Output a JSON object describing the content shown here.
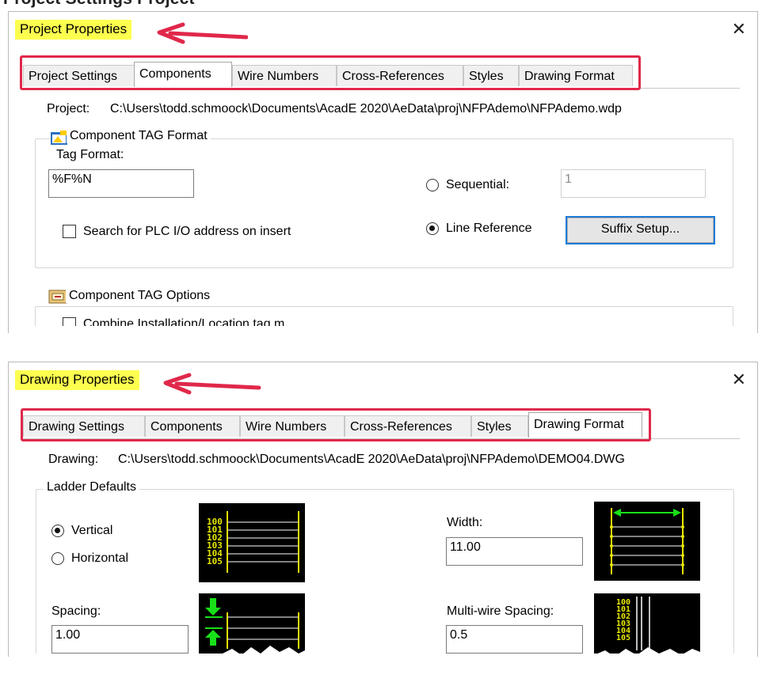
{
  "top_fragment": "Project Settings Project",
  "project_dialog": {
    "title": "Project Properties",
    "close_glyph": "✕",
    "tabs": [
      "Project Settings",
      "Components",
      "Wire Numbers",
      "Cross-References",
      "Styles",
      "Drawing Format"
    ],
    "active_tab": "Components",
    "path_label": "Project:",
    "path_value": "C:\\Users\\todd.schmoock\\Documents\\AcadE 2020\\AeData\\proj\\NFPAdemo\\NFPAdemo.wdp",
    "tag_format_group": "Component TAG Format",
    "tag_format_label": "Tag Format:",
    "tag_format_value": "%F%N",
    "sequential_label": "Sequential:",
    "sequential_value": "1",
    "sequential_selected": false,
    "line_reference_label": "Line Reference",
    "line_reference_selected": true,
    "plc_checkbox_label": "Search for PLC I/O address on insert",
    "plc_checked": false,
    "suffix_button": "Suffix Setup...",
    "tag_options_group": "Component TAG Options",
    "tag_options_partial": "Combine Installation/Location tag m"
  },
  "drawing_dialog": {
    "title": "Drawing Properties",
    "close_glyph": "✕",
    "tabs": [
      "Drawing Settings",
      "Components",
      "Wire Numbers",
      "Cross-References",
      "Styles",
      "Drawing Format"
    ],
    "active_tab": "Drawing Format",
    "path_label": "Drawing:",
    "path_value": "C:\\Users\\todd.schmoock\\Documents\\AcadE 2020\\AeData\\proj\\NFPAdemo\\DEMO04.DWG",
    "ladder_group": "Ladder Defaults",
    "vertical_label": "Vertical",
    "vertical_selected": true,
    "horizontal_label": "Horizontal",
    "horizontal_selected": false,
    "width_label": "Width:",
    "width_value": "11.00",
    "spacing_label": "Spacing:",
    "spacing_value": "1.00",
    "multiwire_label": "Multi-wire Spacing:",
    "multiwire_value": "0.5",
    "ladder_numbers": [
      "100",
      "101",
      "102",
      "103",
      "104",
      "105"
    ]
  },
  "colors": {
    "highlight": "#fdff4f",
    "annotation_red": "#e0284a",
    "focus_blue": "#1e7bd6",
    "preview_bg": "#000000",
    "preview_yellow": "#e8e800",
    "preview_green": "#18e018"
  }
}
